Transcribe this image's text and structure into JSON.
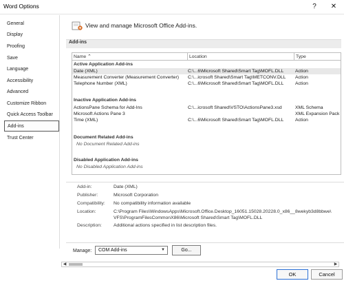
{
  "window": {
    "title": "Word Options",
    "help_icon_glyph": "?",
    "close_icon_glyph": "✕"
  },
  "sidebar": {
    "items": [
      {
        "label": "General"
      },
      {
        "label": "Display"
      },
      {
        "label": "Proofing"
      },
      {
        "label": "Save"
      },
      {
        "label": "Language"
      },
      {
        "label": "Accessibility"
      },
      {
        "label": "Advanced"
      },
      {
        "label": "Customize Ribbon"
      },
      {
        "label": "Quick Access Toolbar"
      },
      {
        "label": "Add-ins",
        "active": true
      },
      {
        "label": "Trust Center"
      }
    ]
  },
  "header": {
    "icon": "add-ins-gear-icon",
    "text": "View and manage Microsoft Office Add-ins."
  },
  "section": {
    "title": "Add-ins"
  },
  "grid": {
    "columns": [
      "Name ⌃",
      "Location",
      "Type"
    ],
    "groups": [
      {
        "title": "Active Application Add-ins",
        "rows": [
          {
            "name": "Date (XML)",
            "location": "C:\\...6\\Microsoft Shared\\Smart Tag\\MOFL.DLL",
            "type": "Action",
            "selected": true
          },
          {
            "name": "Measurement Converter (Measurement Converter)",
            "location": "C:\\...icrosoft Shared\\Smart Tag\\METCONV.DLL",
            "type": "Action"
          },
          {
            "name": "Telephone Number (XML)",
            "location": "C:\\...6\\Microsoft Shared\\Smart Tag\\MOFL.DLL",
            "type": "Action"
          }
        ]
      },
      {
        "title": "Inactive Application Add-ins",
        "rows": [
          {
            "name": "ActionsPane Schema for Add-Ins",
            "location": "C:\\...icrosoft Shared\\VSTO\\ActionsPane3.xsd",
            "type": "XML Schema"
          },
          {
            "name": "Microsoft Actions Pane 3",
            "location": "",
            "type": "XML Expansion Pack"
          },
          {
            "name": "Time (XML)",
            "location": "C:\\...6\\Microsoft Shared\\Smart Tag\\MOFL.DLL",
            "type": "Action"
          }
        ]
      },
      {
        "title": "Document Related Add-ins",
        "empty": "No Document Related Add-ins"
      },
      {
        "title": "Disabled Application Add-ins",
        "empty": "No Disabled Application Add-ins"
      }
    ]
  },
  "details": {
    "addin_label": "Add-in:",
    "addin_value": "Date (XML)",
    "publisher_label": "Publisher:",
    "publisher_value": "Microsoft Corporation",
    "compatibility_label": "Compatibility:",
    "compatibility_value": "No compatibility information available",
    "location_label": "Location:",
    "location_value_1": "C:\\Program Files\\WindowsApps\\Microsoft.Office.Desktop_16051.15028.20228.0_x86__8wekyb3d8bbwe\\",
    "location_value_2": "VFS\\ProgramFilesCommonX86\\Microsoft Shared\\Smart Tag\\MOFL.DLL",
    "description_label": "Description:",
    "description_value": "Additional actions specified in list description files."
  },
  "manage": {
    "label": "Manage:",
    "selected": "COM Add-ins",
    "go_label": "Go..."
  },
  "footer": {
    "ok_label": "OK",
    "cancel_label": "Cancel"
  },
  "colors": {
    "selected_row": "#e8e8e8",
    "ok_border": "#2a6fd6",
    "icon_accent": "#d9702b"
  }
}
